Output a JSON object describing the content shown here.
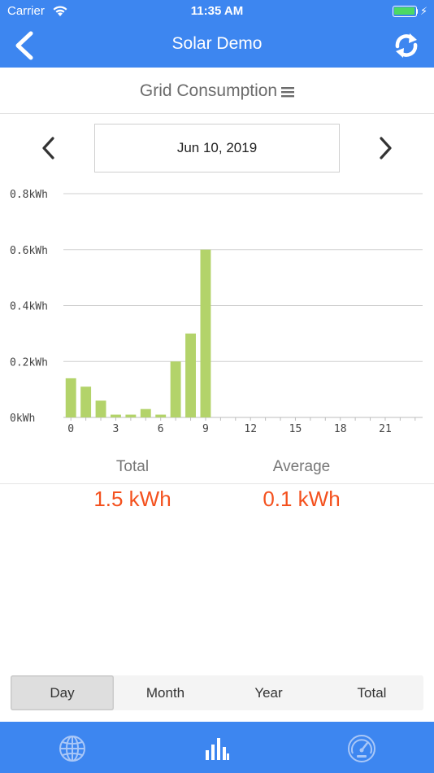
{
  "status": {
    "carrier": "Carrier",
    "time": "11:35 AM",
    "battery_level": 0.9,
    "battery_color": "#4cd964"
  },
  "nav": {
    "title": "Solar Demo",
    "back_icon": "chevron-left-icon",
    "refresh_icon": "refresh-icon",
    "color": "#3d86f0"
  },
  "subheader": {
    "title": "Grid Consumption",
    "menu_icon": "hamburger-menu-icon"
  },
  "date_selector": {
    "date": "Jun 10, 2019",
    "prev_icon": "chevron-left-icon",
    "next_icon": "chevron-right-icon"
  },
  "chart_data": {
    "type": "bar",
    "unit": "kWh",
    "y_tick_labels": [
      "0kWh",
      "0.2kWh",
      "0.4kWh",
      "0.6kWh",
      "0.8kWh"
    ],
    "y_ticks": [
      0,
      0.2,
      0.4,
      0.6,
      0.8
    ],
    "ylim": [
      0,
      0.8
    ],
    "x_tick_labels": [
      "0",
      "3",
      "6",
      "9",
      "12",
      "15",
      "18",
      "21"
    ],
    "x_ticks": [
      0,
      3,
      6,
      9,
      12,
      15,
      18,
      21
    ],
    "xlim": [
      -0.5,
      23.5
    ],
    "x": [
      0,
      1,
      2,
      3,
      4,
      5,
      6,
      7,
      8,
      9
    ],
    "values": [
      0.14,
      0.11,
      0.06,
      0.01,
      0.01,
      0.03,
      0.01,
      0.2,
      0.3,
      0.6
    ],
    "bar_color": "#b3d36a",
    "grid": true
  },
  "summary": {
    "total_label": "Total",
    "total_value": "1.5 kWh",
    "average_label": "Average",
    "average_value": "0.1 kWh",
    "value_color": "#f4511e"
  },
  "period_tabs": {
    "items": [
      "Day",
      "Month",
      "Year",
      "Total"
    ],
    "selected": "Day"
  },
  "tabbar": {
    "items": [
      "globe-icon",
      "bar-chart-icon",
      "speedometer-icon"
    ],
    "selected": "bar-chart-icon"
  }
}
